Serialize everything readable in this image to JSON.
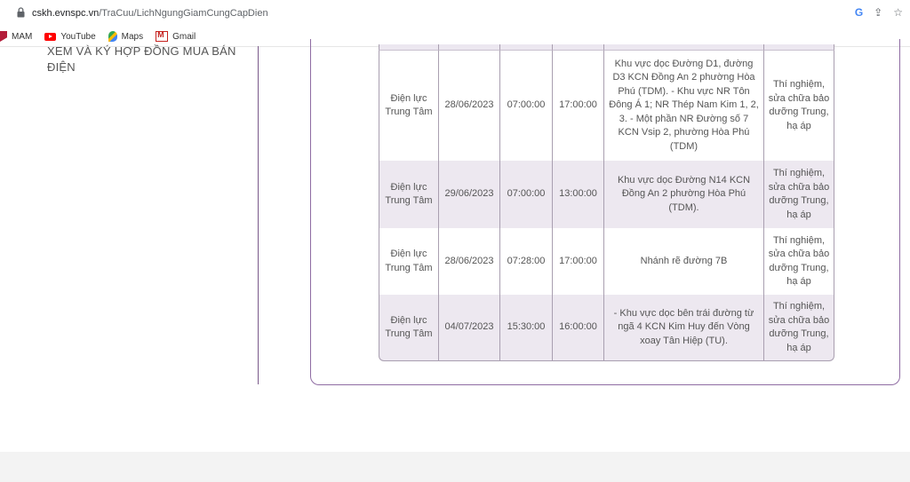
{
  "browser": {
    "url_host": "cskh.evnspc.vn",
    "url_path": "/TraCuu/LichNgungGiamCungCapDien",
    "bookmarks": [
      {
        "label": "MAM",
        "icon": "mam-logo-icon"
      },
      {
        "label": "YouTube",
        "icon": "youtube-icon"
      },
      {
        "label": "Maps",
        "icon": "maps-icon"
      },
      {
        "label": "Gmail",
        "icon": "gmail-icon"
      }
    ]
  },
  "sidebar": {
    "link_text": "XEM VÀ KÝ HỢP ĐỒNG MUA BÁN ĐIỆN"
  },
  "table": {
    "rows": [
      {
        "unit": "Điện lực Trung Tâm",
        "date": "28/06/2023",
        "from": "07:00:00",
        "to": "17:00:00",
        "area": "Khu vực dọc Đường D1, đường D3 KCN Đồng An 2 phường Hòa Phú (TDM). - Khu vực NR Tôn Đông Á 1; NR Thép Nam Kim 1, 2, 3. - Một phần NR Đường số 7 KCN Vsip 2, phường Hòa Phú (TDM)",
        "reason": "Thí nghiệm, sửa chữa bảo dưỡng Trung, hạ áp"
      },
      {
        "unit": "Điện lực Trung Tâm",
        "date": "29/06/2023",
        "from": "07:00:00",
        "to": "13:00:00",
        "area": "Khu vực dọc Đường N14 KCN Đồng An 2 phường Hòa Phú (TDM).",
        "reason": "Thí nghiệm, sửa chữa bảo dưỡng Trung, hạ áp"
      },
      {
        "unit": "Điện lực Trung Tâm",
        "date": "28/06/2023",
        "from": "07:28:00",
        "to": "17:00:00",
        "area": "Nhánh rẽ đường 7B",
        "reason": "Thí nghiệm, sửa chữa bảo dưỡng Trung, hạ áp"
      },
      {
        "unit": "Điện lực Trung Tâm",
        "date": "04/07/2023",
        "from": "15:30:00",
        "to": "16:00:00",
        "area": "- Khu vực dọc bên trái đường từ ngã 4 KCN Kim Huy đến Vòng xoay Tân Hiệp (TU).",
        "reason": "Thí nghiệm, sửa chữa bảo dưỡng Trung, hạ áp"
      }
    ]
  }
}
